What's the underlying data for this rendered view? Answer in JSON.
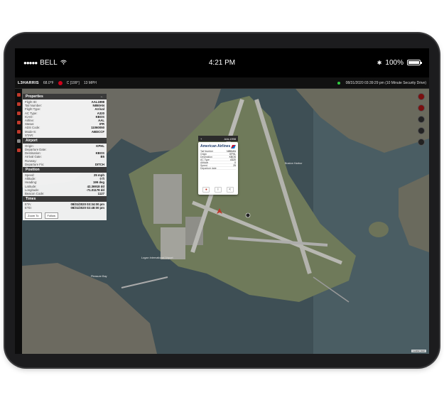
{
  "ios": {
    "carrier": "BELL",
    "time": "4:21 PM",
    "battery": "100%"
  },
  "app_bar": {
    "brand": "L3HARRIS",
    "temp": "68.0°F",
    "wind": "C [199°]",
    "speed": "13 MPH",
    "status": "08/31/2020 03:39:29 pm (10 Minute Security Drive)"
  },
  "properties": {
    "title": "Properties",
    "rows": [
      {
        "k": "Flight ID:",
        "v": "AAL1998"
      },
      {
        "k": "Tail Number:",
        "v": "N850AN"
      },
      {
        "k": "Flight Type:",
        "v": "Arrival"
      },
      {
        "k": "AC Type:",
        "v": "A320"
      },
      {
        "k": "ICAO:",
        "v": "KBOS"
      },
      {
        "k": "Airline:",
        "v": "AAL"
      },
      {
        "k": "Status:",
        "v": "IFR"
      },
      {
        "k": "ADS Code:",
        "v": "11060050"
      },
      {
        "k": "Mode-S:",
        "v": "ABDCCF"
      },
      {
        "k": "STAR:",
        "v": ""
      }
    ]
  },
  "airport": {
    "title": "Airport",
    "rows": [
      {
        "k": "Origin:",
        "v": "KPHL"
      },
      {
        "k": "Departure Date:",
        "v": ""
      },
      {
        "k": "Destination:",
        "v": "KBOS"
      },
      {
        "k": "Arrival Gate:",
        "v": "B5"
      },
      {
        "k": "Runway:",
        "v": ""
      },
      {
        "k": "Departure Fix:",
        "v": "DITCH"
      }
    ]
  },
  "position": {
    "title": "Position",
    "rows": [
      {
        "k": "Speed:",
        "v": "25 mph"
      },
      {
        "k": "Altitude:",
        "v": "0 ft"
      },
      {
        "k": "Heading:",
        "v": "199 deg"
      },
      {
        "k": "Latitude:",
        "v": "42.36918 dd"
      },
      {
        "k": "Longitude:",
        "v": "-71.01178 dd"
      },
      {
        "k": "Beacon Code:",
        "v": "1127"
      }
    ]
  },
  "times": {
    "title": "Times",
    "rows": [
      {
        "k": "ETA:",
        "v": "08/31/2020 03:34:00 pm"
      },
      {
        "k": "ETD:",
        "v": "08/31/2020 02:48:00 pm"
      }
    ],
    "zoom_btn": "Zoom To",
    "follow_btn": "Follow"
  },
  "popup": {
    "callsign": "AAL1998",
    "airline": "American Airlines",
    "rows": [
      {
        "k": "Tail Number",
        "v": "N850AN"
      },
      {
        "k": "Origin",
        "v": "KPHL"
      },
      {
        "k": "Destination",
        "v": "KBOS"
      },
      {
        "k": "AC Type",
        "v": "A320"
      },
      {
        "k": "Altitude",
        "v": "0"
      },
      {
        "k": "Speed",
        "v": "25"
      },
      {
        "k": "Departure date",
        "v": ""
      }
    ]
  },
  "map": {
    "label_harbor": "Boston Harbor",
    "label_logan": "Logan International Airport",
    "label_bay": "Pleasure Bay"
  },
  "colors": {
    "accent": "#c0392b",
    "panel_header": "#3a3a3a"
  }
}
